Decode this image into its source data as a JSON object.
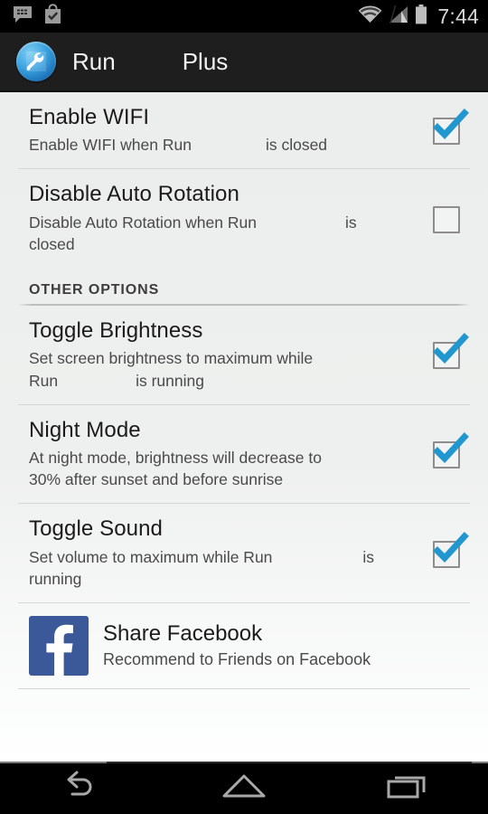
{
  "status_bar": {
    "time": "7:44",
    "left_icons": [
      "bbm-message-icon",
      "play-store-bag-icon"
    ],
    "right_icons": [
      "wifi-icon",
      "cellular-signal-icon",
      "battery-icon"
    ]
  },
  "action_bar": {
    "icon": "app-wrench-icon",
    "title_part_1": "Run",
    "title_part_2": "Plus"
  },
  "settings": {
    "items": [
      {
        "title": "Enable WIFI",
        "sub_before": "Enable WIFI when Run",
        "sub_after": "is closed",
        "checked": true,
        "name": "enable-wifi"
      },
      {
        "title": "Disable Auto Rotation",
        "sub_before": "Disable Auto Rotation when Run",
        "sub_after": "is\nclosed",
        "checked": false,
        "name": "disable-auto-rotation"
      }
    ],
    "section_header": "OTHER OPTIONS",
    "other_items": [
      {
        "title": "Toggle Brightness",
        "sub_before": "Set screen brightness to maximum while\nRun",
        "sub_after": "is running",
        "checked": true,
        "name": "toggle-brightness"
      },
      {
        "title": "Night Mode",
        "sub_before": "At night mode, brightness will decrease to\n30% after sunset and before sunrise",
        "sub_after": "",
        "checked": true,
        "name": "night-mode"
      },
      {
        "title": "Toggle Sound",
        "sub_before": "Set volume to maximum while Run",
        "sub_after": "is\nrunning",
        "checked": true,
        "name": "toggle-sound"
      }
    ]
  },
  "facebook": {
    "title": "Share Facebook",
    "subtitle": "Recommend to Friends on Facebook",
    "icon": "facebook-icon",
    "brand_color": "#3b5998"
  },
  "nav_bar": {
    "buttons": [
      "back-icon",
      "home-icon",
      "recents-icon"
    ]
  },
  "colors": {
    "accent": "#2196cf",
    "action_bar": "#1e1e1e",
    "list_background": "#eef0ef",
    "facebook_blue": "#3b5998"
  }
}
